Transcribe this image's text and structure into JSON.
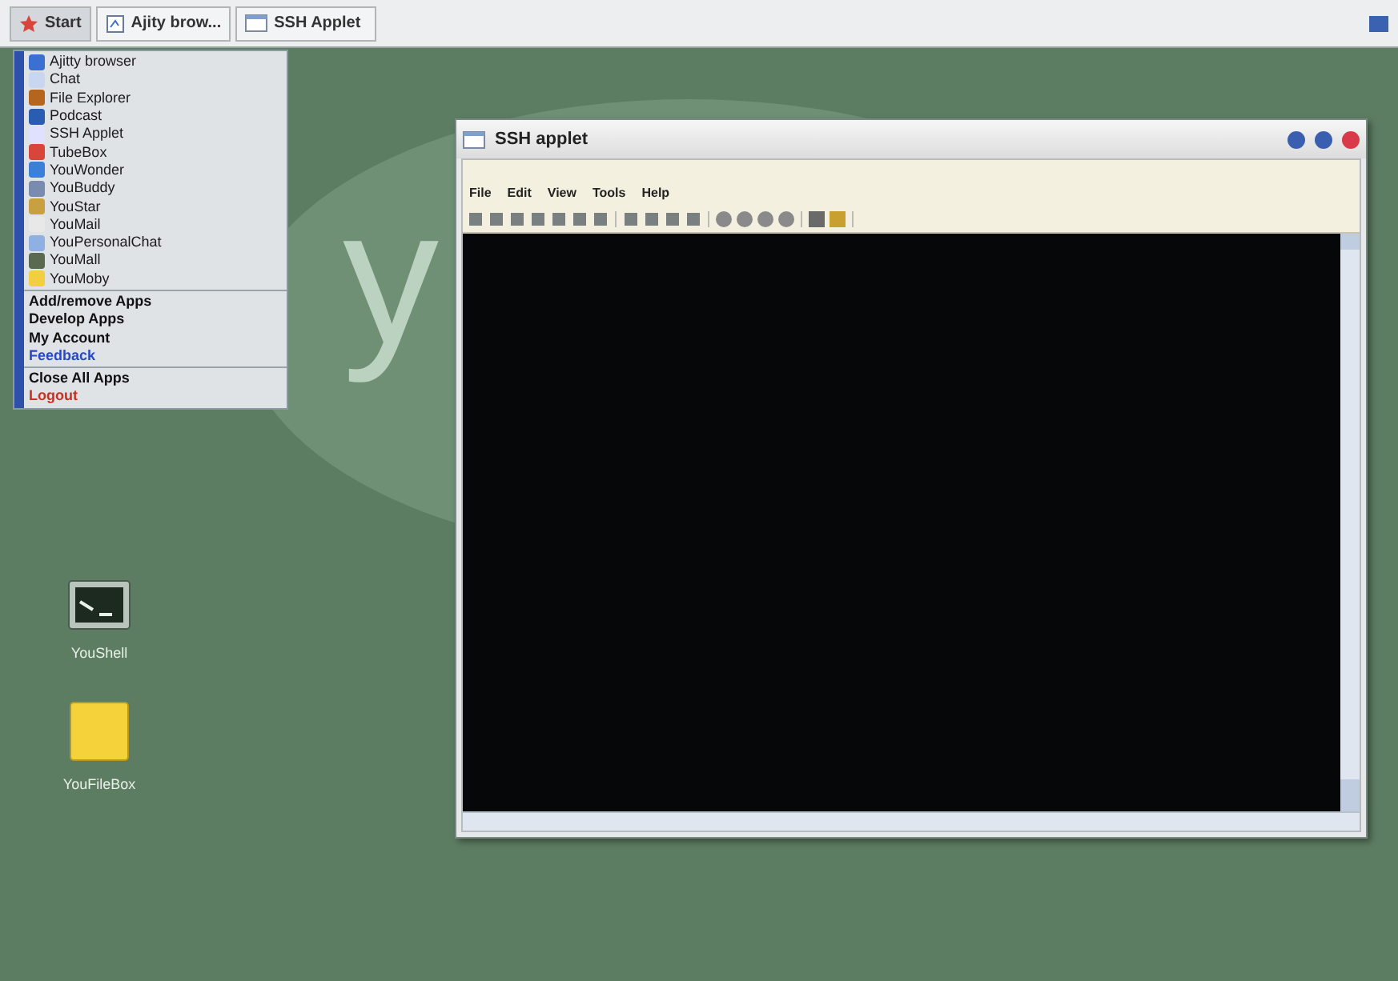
{
  "taskbar": {
    "tabs": [
      {
        "label": "Start",
        "kind": "start",
        "selected": true
      },
      {
        "label": "Ajity brow...",
        "kind": "browser",
        "selected": false
      },
      {
        "label": "SSH Applet",
        "kind": "window",
        "selected": false
      }
    ]
  },
  "start_menu": {
    "sections": [
      [
        {
          "label": "Ajitty browser",
          "kind": "app"
        },
        {
          "label": "Chat",
          "kind": "app"
        },
        {
          "label": "File Explorer",
          "kind": "app"
        },
        {
          "label": "Podcast",
          "kind": "app"
        },
        {
          "label": "SSH Applet",
          "kind": "app"
        },
        {
          "label": "TubeBox",
          "kind": "app"
        },
        {
          "label": "YouWonder",
          "kind": "app"
        },
        {
          "label": "YouBuddy",
          "kind": "app"
        },
        {
          "label": "YouStar",
          "kind": "app"
        },
        {
          "label": "YouMail",
          "kind": "app"
        },
        {
          "label": "YouPersonalChat",
          "kind": "app"
        },
        {
          "label": "YouMall",
          "kind": "app"
        },
        {
          "label": "YouMoby",
          "kind": "app"
        }
      ],
      [
        {
          "label": "Add/remove Apps",
          "kind": "action"
        },
        {
          "label": "Develop Apps",
          "kind": "action"
        },
        {
          "label": "My Account",
          "kind": "action"
        },
        {
          "label": "Feedback",
          "kind": "link"
        }
      ],
      [
        {
          "label": "Close All Apps",
          "kind": "action"
        },
        {
          "label": "Logout",
          "kind": "danger"
        }
      ]
    ]
  },
  "wallpaper": {
    "logo": "y"
  },
  "desktop_icons": [
    {
      "label": "YouShell",
      "kind": "shell"
    },
    {
      "label": "YouFileBox",
      "kind": "folder"
    }
  ],
  "window": {
    "title": "SSH applet",
    "menu": [
      "File",
      "Edit",
      "View",
      "Tools",
      "Help"
    ]
  }
}
